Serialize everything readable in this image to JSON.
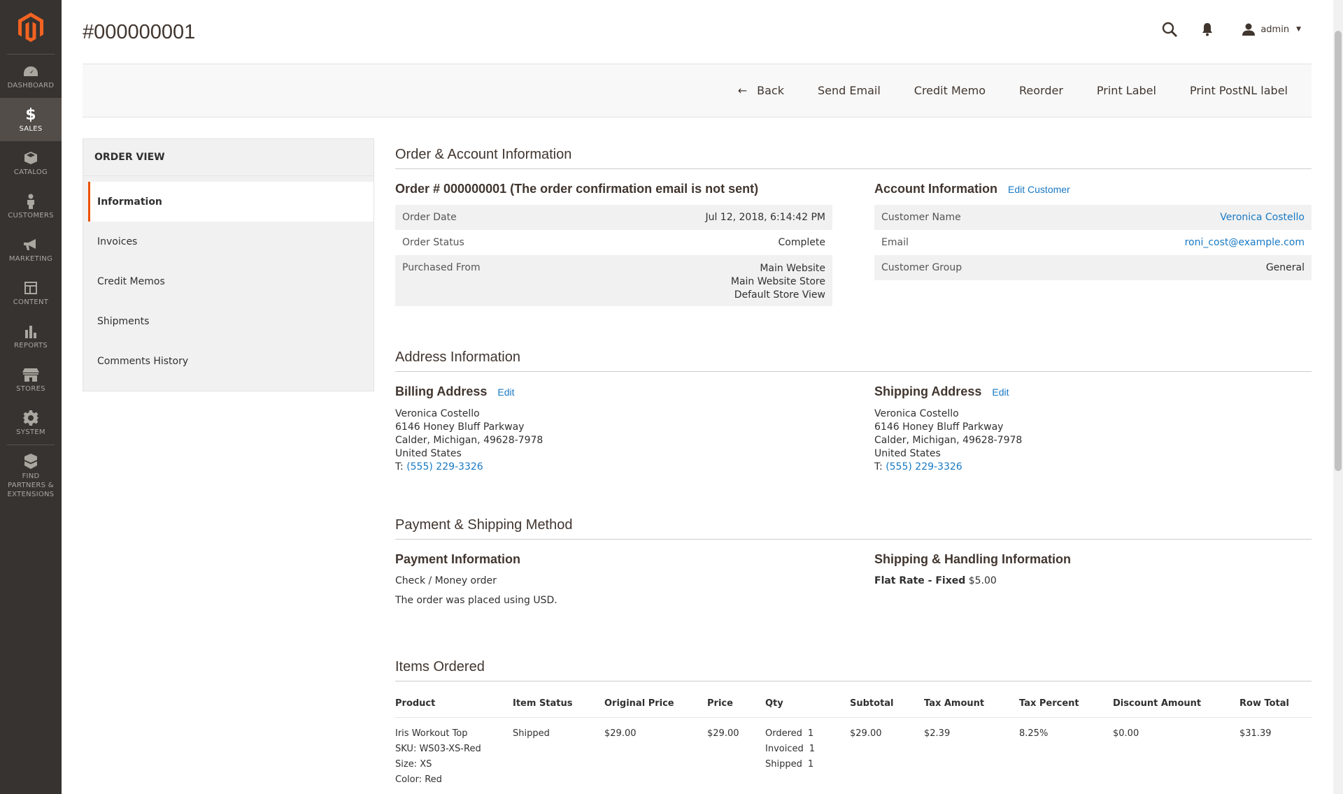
{
  "sidebar": {
    "items": [
      {
        "label": "DASHBOARD",
        "icon": "dashboard-icon"
      },
      {
        "label": "SALES",
        "icon": "dollar-icon"
      },
      {
        "label": "CATALOG",
        "icon": "cube-icon"
      },
      {
        "label": "CUSTOMERS",
        "icon": "person-icon"
      },
      {
        "label": "MARKETING",
        "icon": "megaphone-icon"
      },
      {
        "label": "CONTENT",
        "icon": "layout-icon"
      },
      {
        "label": "REPORTS",
        "icon": "bar-chart-icon"
      },
      {
        "label": "STORES",
        "icon": "storefront-icon"
      },
      {
        "label": "SYSTEM",
        "icon": "gear-icon"
      }
    ],
    "partners": [
      "FIND",
      "PARTNERS &",
      "EXTENSIONS"
    ]
  },
  "header": {
    "title": "#000000001",
    "user": "admin"
  },
  "actions": {
    "back": "Back",
    "send_email": "Send Email",
    "credit_memo": "Credit Memo",
    "reorder": "Reorder",
    "print_label": "Print Label",
    "print_postnl": "Print PostNL label"
  },
  "tabs": {
    "title": "ORDER VIEW",
    "items": [
      "Information",
      "Invoices",
      "Credit Memos",
      "Shipments",
      "Comments History"
    ]
  },
  "order_account": {
    "section_title": "Order & Account Information",
    "order_heading": "Order # 000000001 (The order confirmation email is not sent)",
    "order_date_label": "Order Date",
    "order_date": "Jul 12, 2018, 6:14:42 PM",
    "order_status_label": "Order Status",
    "order_status": "Complete",
    "purchased_from_label": "Purchased From",
    "purchased_from": [
      "Main Website",
      "Main Website Store",
      "Default Store View"
    ],
    "account_heading": "Account Information",
    "edit_customer": "Edit Customer",
    "customer_name_label": "Customer Name",
    "customer_name": "Veronica Costello",
    "email_label": "Email",
    "email": "roni_cost@example.com",
    "customer_group_label": "Customer Group",
    "customer_group": "General"
  },
  "address": {
    "section_title": "Address Information",
    "billing_heading": "Billing Address",
    "shipping_heading": "Shipping Address",
    "edit": "Edit",
    "name": "Veronica Costello",
    "street": "6146 Honey Bluff Parkway",
    "city": "Calder, Michigan, 49628-7978",
    "country": "United States",
    "phone_prefix": "T:",
    "phone": "(555) 229-3326"
  },
  "payment": {
    "section_title": "Payment & Shipping Method",
    "payment_heading": "Payment Information",
    "method": "Check / Money order",
    "currency_note": "The order was placed using USD.",
    "shipping_heading": "Shipping & Handling Information",
    "shipping_method": "Flat Rate - Fixed",
    "shipping_price": "$5.00"
  },
  "items": {
    "section_title": "Items Ordered",
    "columns": [
      "Product",
      "Item Status",
      "Original Price",
      "Price",
      "Qty",
      "Subtotal",
      "Tax Amount",
      "Tax Percent",
      "Discount Amount",
      "Row Total"
    ],
    "rows": [
      {
        "product": "Iris Workout Top",
        "sku": "SKU: WS03-XS-Red",
        "size": "Size: XS",
        "color": "Color: Red",
        "status": "Shipped",
        "original_price": "$29.00",
        "price": "$29.00",
        "qty_ordered_label": "Ordered",
        "qty_ordered": "1",
        "qty_invoiced_label": "Invoiced",
        "qty_invoiced": "1",
        "qty_shipped_label": "Shipped",
        "qty_shipped": "1",
        "subtotal": "$29.00",
        "tax_amount": "$2.39",
        "tax_percent": "8.25%",
        "discount": "$0.00",
        "row_total": "$31.39"
      }
    ]
  },
  "colors": {
    "sidebar_bg": "#373330",
    "accent": "#eb5202",
    "link": "#1979c3"
  }
}
